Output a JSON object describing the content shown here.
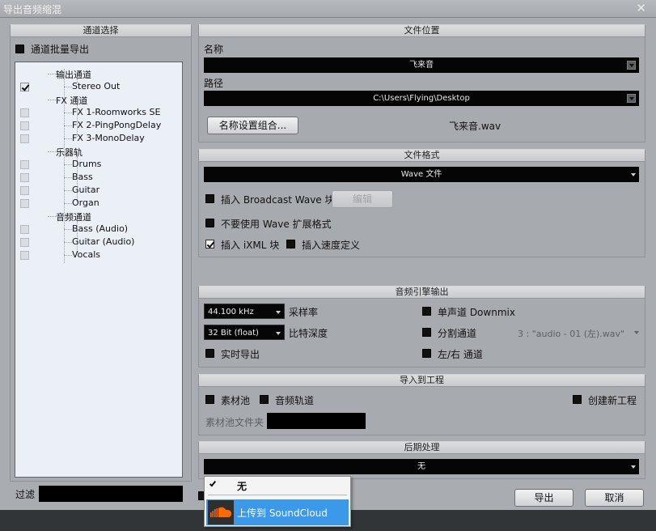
{
  "window": {
    "title": "导出音频缩混",
    "close_glyph": "✕"
  },
  "channel_panel": {
    "header": "通道选择",
    "batch_export_label": "通道批量导出",
    "tree": [
      {
        "label": "输出通道",
        "level": 0,
        "checkbox": false
      },
      {
        "label": "Stereo Out",
        "level": 1,
        "checkbox": true,
        "checked": true
      },
      {
        "label": "FX 通道",
        "level": 0,
        "checkbox": false
      },
      {
        "label": "FX 1-Roomworks SE",
        "level": 1,
        "checkbox": true,
        "checked": false
      },
      {
        "label": "FX 2-PingPongDelay",
        "level": 1,
        "checkbox": true,
        "checked": false
      },
      {
        "label": "FX 3-MonoDelay",
        "level": 1,
        "checkbox": true,
        "checked": false
      },
      {
        "label": "乐器轨",
        "level": 0,
        "checkbox": false
      },
      {
        "label": "Drums",
        "level": 1,
        "checkbox": true,
        "checked": false
      },
      {
        "label": "Bass",
        "level": 1,
        "checkbox": true,
        "checked": false
      },
      {
        "label": "Guitar",
        "level": 1,
        "checkbox": true,
        "checked": false
      },
      {
        "label": "Organ",
        "level": 1,
        "checkbox": true,
        "checked": false
      },
      {
        "label": "音频通道",
        "level": 0,
        "checkbox": false
      },
      {
        "label": "Bass (Audio)",
        "level": 1,
        "checkbox": true,
        "checked": false
      },
      {
        "label": "Guitar (Audio)",
        "level": 1,
        "checkbox": true,
        "checked": false
      },
      {
        "label": "Vocals",
        "level": 1,
        "checkbox": true,
        "checked": false
      }
    ],
    "filter_label": "过滤"
  },
  "file_location": {
    "header": "文件位置",
    "name_label": "名称",
    "name_value": "飞来音",
    "path_label": "路径",
    "path_value": "C:\\Users\\Flying\\Desktop",
    "naming_button": "名称设置组合...",
    "filename_preview": "飞来音.wav"
  },
  "file_format": {
    "header": "文件格式",
    "format_value": "Wave 文件",
    "insert_bwf_label": "插入 Broadcast Wave 块",
    "edit_button": "编辑",
    "no_wave_ext_label": "不要使用 Wave 扩展格式",
    "insert_ixml_label": "插入 iXML 块",
    "insert_tempo_label": "插入速度定义"
  },
  "engine_output": {
    "header": "音频引擎输出",
    "sample_rate_value": "44.100 kHz",
    "sample_rate_label": "采样率",
    "bit_depth_value": "32 Bit (float)",
    "bit_depth_label": "比特深度",
    "realtime_label": "实时导出",
    "mono_downmix_label": "单声道 Downmix",
    "split_channels_label": "分割通道",
    "split_channels_value": "3 : \"audio - 01 (左).wav\"",
    "lr_channels_label": "左/右 通道"
  },
  "import_project": {
    "header": "导入到工程",
    "pool_label": "素材池",
    "audio_track_label": "音频轨道",
    "new_project_label": "创建新工程",
    "pool_folder_label": "素材池文件夹"
  },
  "post_process": {
    "header": "后期处理",
    "value": "无",
    "menu": [
      {
        "label": "无",
        "checked": true
      },
      {
        "label": "上传到 SoundCloud",
        "checked": false,
        "highlighted": true
      }
    ]
  },
  "footer": {
    "export_button": "导出",
    "cancel_button": "取消"
  },
  "colors": {
    "dialog_bg": "#a9acb0",
    "field_bg": "#050505",
    "tree_bg": "#eaf0f6",
    "menu_highlight": "#3c98e8",
    "soundcloud_orange": "#ff6a00"
  }
}
